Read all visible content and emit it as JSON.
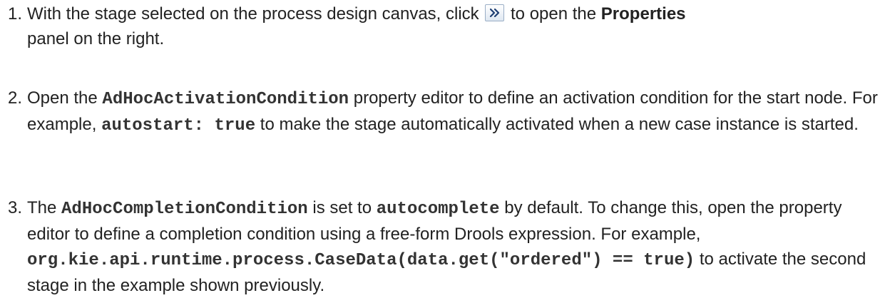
{
  "steps": [
    {
      "number": "1.",
      "text_a": "With the stage selected on the process design canvas, click ",
      "icon": "double-chevron-right-icon",
      "text_b": " to open the ",
      "bold_properties": "Properties",
      "text_c": " panel on the right."
    },
    {
      "number": "2.",
      "text_a": "Open the ",
      "code_property": "AdHocActivationCondition",
      "text_b": " property editor to define an activation condition for the start node. For example, ",
      "code_example": "autostart: true",
      "text_c": " to make the stage automatically activated when a new case instance is started."
    },
    {
      "number": "3.",
      "text_a": "The ",
      "code_property": "AdHocCompletionCondition",
      "text_b": " is set to ",
      "code_default": "autocomplete",
      "text_c": " by default. To change this, open the property editor to define a completion condition using a free-form Drools expression. For example, ",
      "code_example": "org.kie.api.runtime.process.CaseData(data.get(\"ordered\") == true)",
      "text_d": " to activate the second stage in the example shown previously."
    }
  ]
}
